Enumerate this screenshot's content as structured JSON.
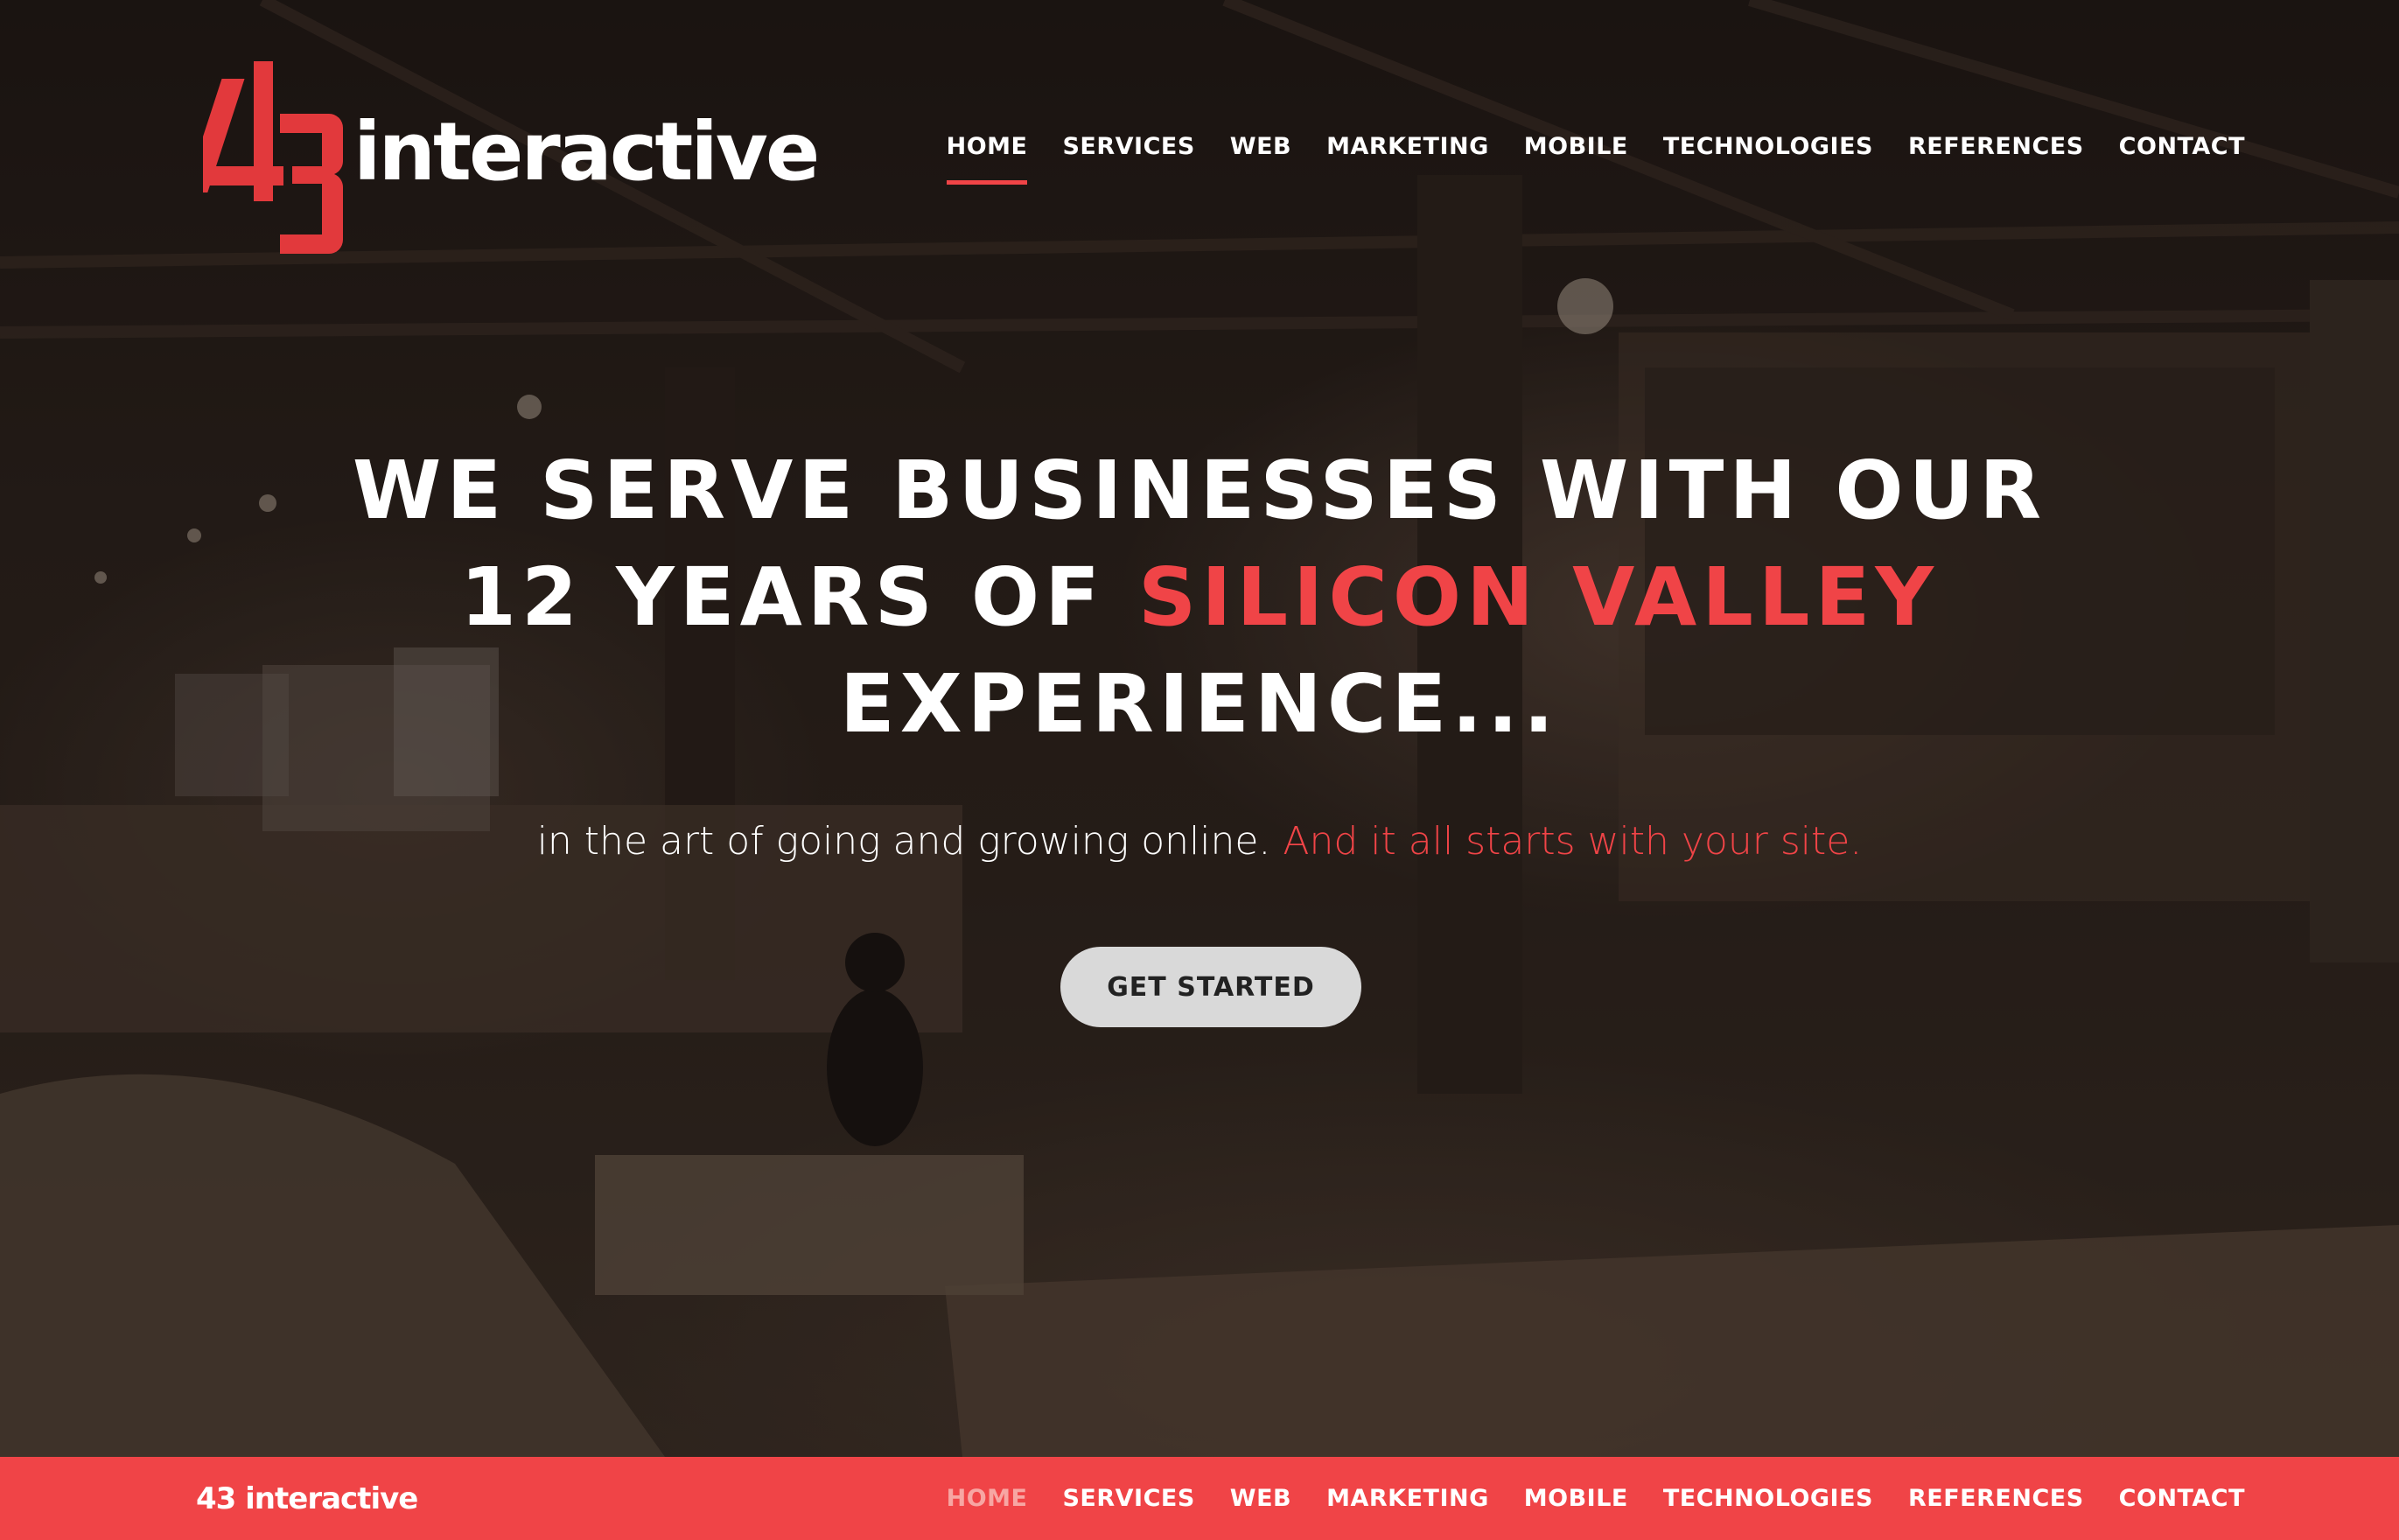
{
  "brand": {
    "logo_number": "43",
    "logo_word": "interactive",
    "sticky_logo": "43 interactive",
    "accent_color": "#f04447"
  },
  "nav": {
    "items": [
      {
        "label": "HOME",
        "active": true
      },
      {
        "label": "SERVICES"
      },
      {
        "label": "WEB"
      },
      {
        "label": "MARKETING"
      },
      {
        "label": "MOBILE"
      },
      {
        "label": "TECHNOLOGIES"
      },
      {
        "label": "REFERENCES"
      },
      {
        "label": "CONTACT"
      }
    ]
  },
  "hero": {
    "headline_line1": "WE SERVE BUSINESSES WITH OUR",
    "headline_line2_prefix": "12 YEARS OF ",
    "headline_line2_accent": "SILICON VALLEY",
    "headline_line3": "EXPERIENCE...",
    "tagline_prefix": "in the art of going and growing online. ",
    "tagline_accent": "And it all starts with your site.",
    "cta_label": "GET STARTED"
  }
}
